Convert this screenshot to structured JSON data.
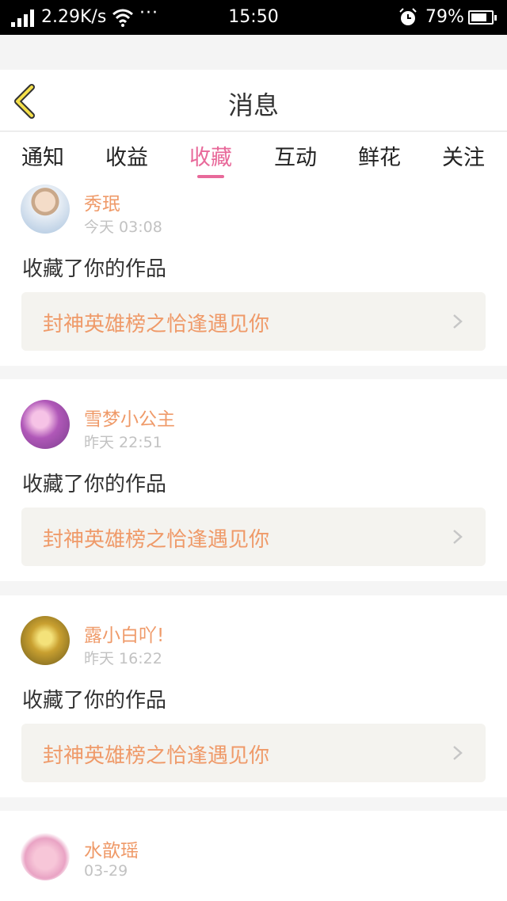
{
  "status_bar": {
    "speed": "2.29K/s",
    "dots": "···",
    "time": "15:50",
    "battery": "79%",
    "battery_level": 0.79
  },
  "header": {
    "title": "消息"
  },
  "tabs": [
    {
      "label": "通知",
      "active": false
    },
    {
      "label": "收益",
      "active": false
    },
    {
      "label": "收藏",
      "active": true
    },
    {
      "label": "互动",
      "active": false
    },
    {
      "label": "鲜花",
      "active": false
    },
    {
      "label": "关注",
      "active": false
    }
  ],
  "colors": {
    "accent": "#e8699a",
    "name": "#ef9a69",
    "link_bg": "#f4f3ef"
  },
  "messages": [
    {
      "user": "秀珉",
      "time": "今天 03:08",
      "action": "收藏了你的作品",
      "work": "封神英雄榜之恰逢遇见你"
    },
    {
      "user": "雪梦小公主",
      "time": "昨天 22:51",
      "action": "收藏了你的作品",
      "work": "封神英雄榜之恰逢遇见你"
    },
    {
      "user": "露小白吖!",
      "time": "昨天 16:22",
      "action": "收藏了你的作品",
      "work": "封神英雄榜之恰逢遇见你"
    },
    {
      "user": "水歆瑶",
      "time": "03-29"
    }
  ]
}
